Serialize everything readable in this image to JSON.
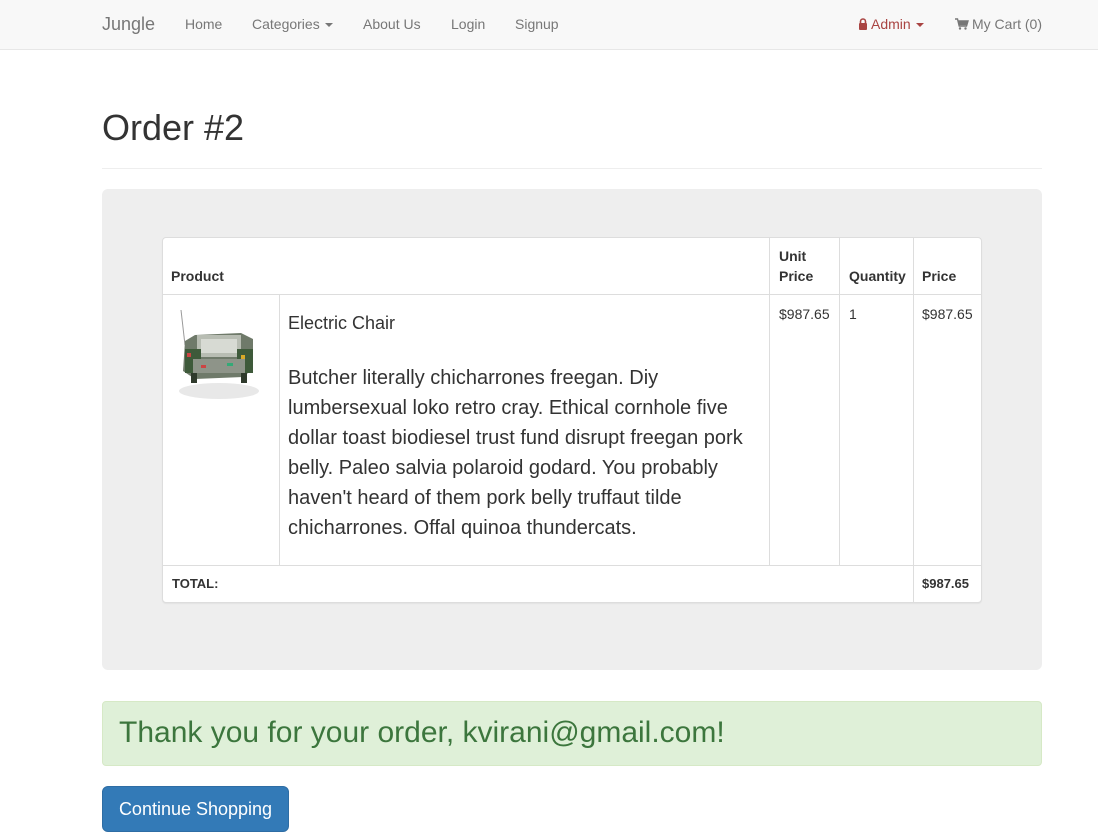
{
  "navbar": {
    "brand": "Jungle",
    "links": {
      "home": "Home",
      "categories": "Categories",
      "about": "About Us",
      "login": "Login",
      "signup": "Signup"
    },
    "admin": "Admin",
    "cart": "My Cart (0)"
  },
  "page": {
    "title": "Order #2"
  },
  "order_table": {
    "headers": {
      "product": "Product",
      "unit_price": "Unit Price",
      "quantity": "Quantity",
      "price": "Price"
    },
    "items": [
      {
        "name": "Electric Chair",
        "description": "Butcher literally chicharrones freegan. Diy lumbersexual loko retro cray. Ethical cornhole five dollar toast biodiesel trust fund disrupt freegan pork belly. Paleo salvia polaroid godard. You probably haven't heard of them pork belly truffaut tilde chicharrones. Offal quinoa thundercats.",
        "unit_price": "$987.65",
        "quantity": "1",
        "price": "$987.65"
      }
    ],
    "total_label": "TOTAL:",
    "total_value": "$987.65"
  },
  "alert": {
    "message": "Thank you for your order, kvirani@gmail.com!"
  },
  "actions": {
    "continue_shopping": "Continue Shopping"
  },
  "colors": {
    "primary": "#337ab7",
    "success_bg": "#dff0d8",
    "success_text": "#3c763d",
    "admin": "#a94442"
  }
}
